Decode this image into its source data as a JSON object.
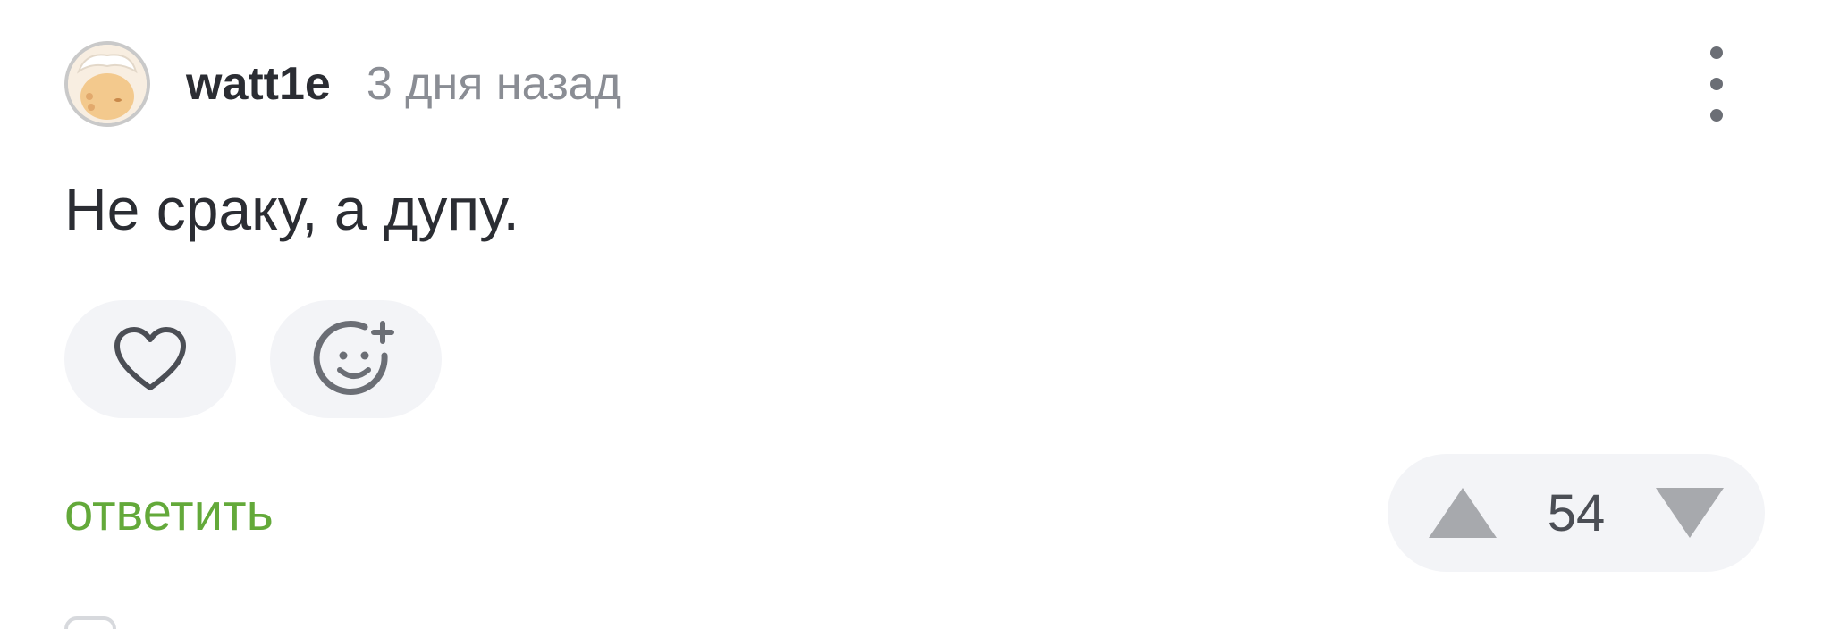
{
  "comment": {
    "author": "watt1e",
    "time": "3 дня назад",
    "text": "Не сраку, а дупу.",
    "reply_label": "ответить",
    "rating": "54"
  },
  "icons": {
    "like": "heart-icon",
    "add_reaction": "emoji-plus-icon",
    "more": "more-vertical-icon",
    "upvote": "triangle-up-icon",
    "downvote": "triangle-down-icon"
  },
  "colors": {
    "reply": "#63a93a",
    "muted": "#8a8d94",
    "pill_bg": "#f3f4f7",
    "text": "#2b2d33"
  }
}
